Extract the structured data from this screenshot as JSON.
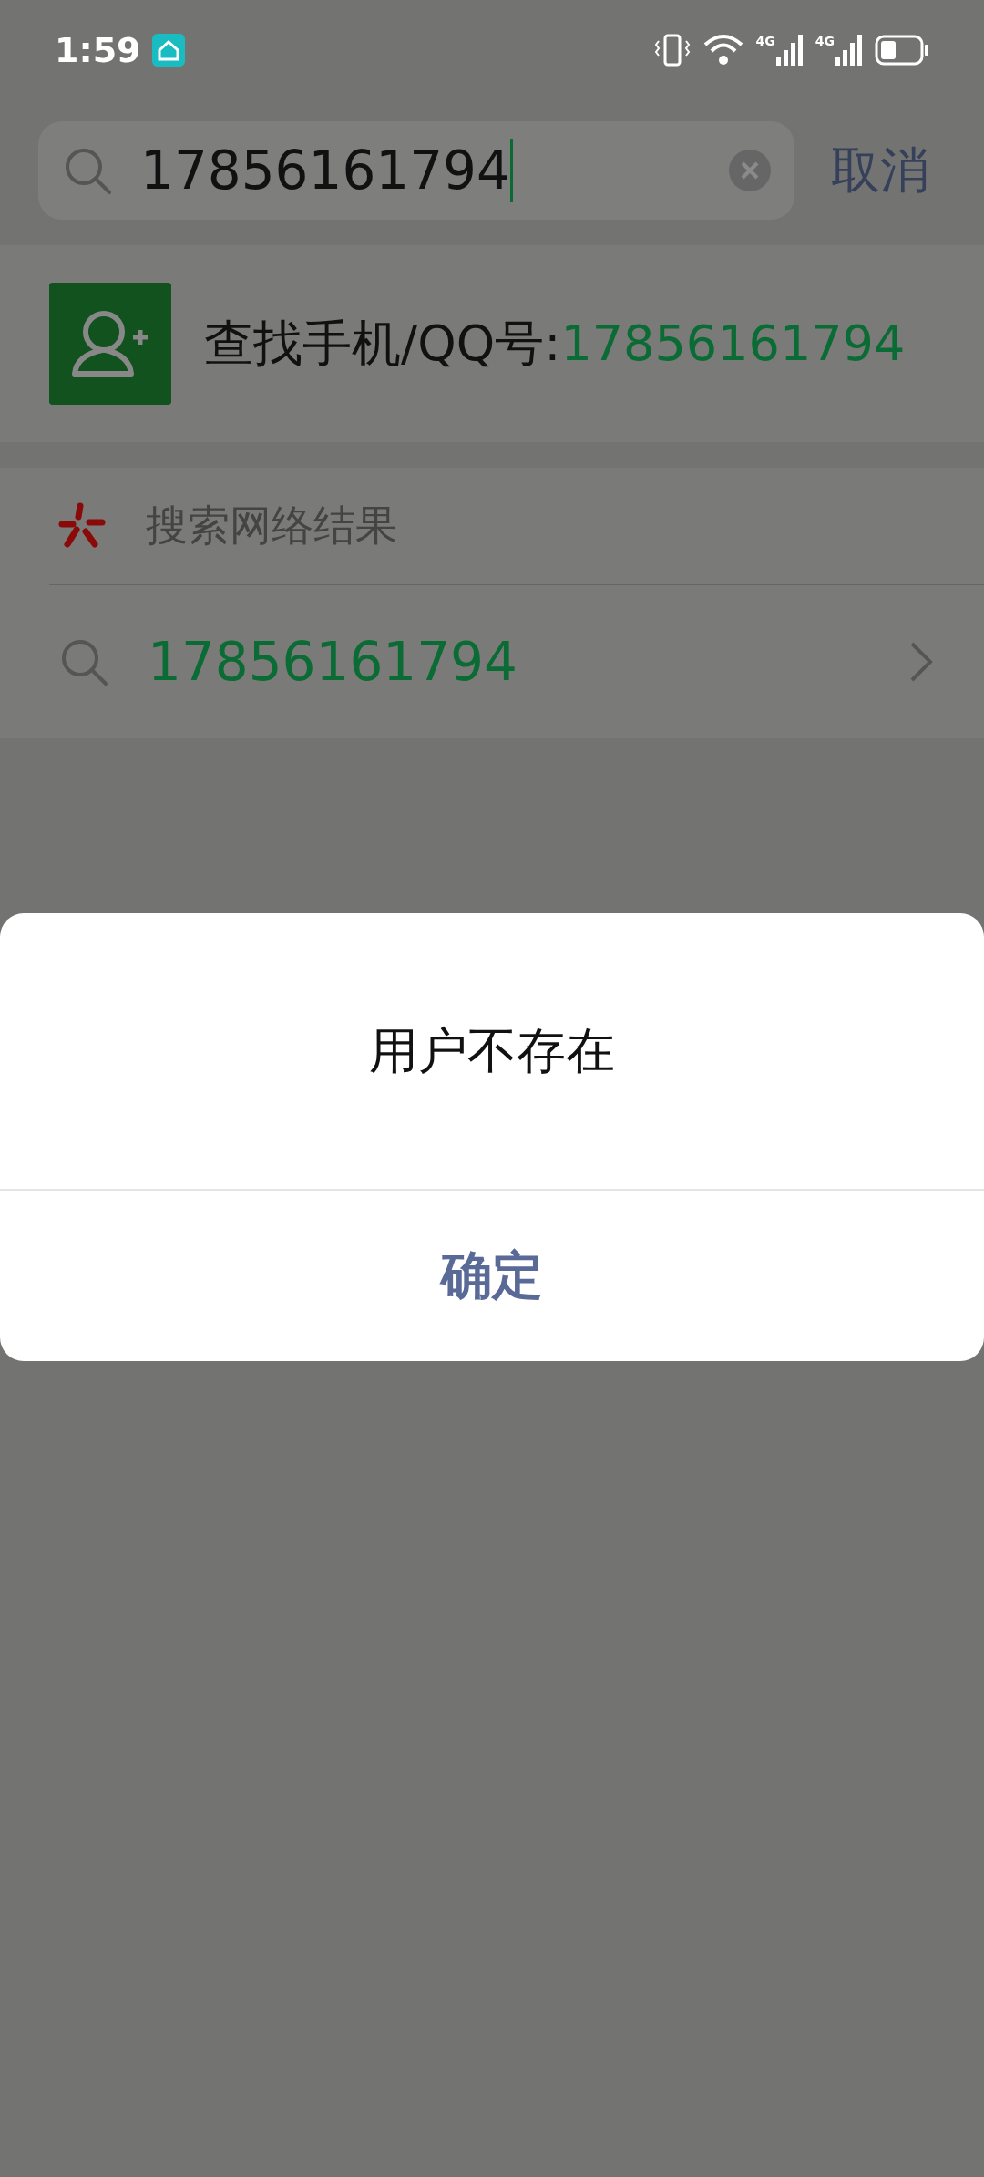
{
  "status_bar": {
    "time": "1:59",
    "signals": [
      {
        "label": "4G"
      },
      {
        "label": "4G"
      }
    ]
  },
  "search": {
    "value": "17856161794",
    "cancel": "取消"
  },
  "find_contact": {
    "label": "查找手机/QQ号:",
    "value": "17856161794"
  },
  "web_search": {
    "title": "搜索网络结果",
    "query": "17856161794"
  },
  "dialog": {
    "message": "用户不存在",
    "button": "确定"
  }
}
